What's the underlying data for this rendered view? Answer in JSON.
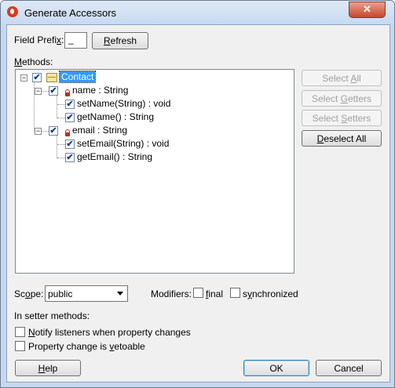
{
  "window": {
    "title": "Generate Accessors",
    "close_glyph": "✕"
  },
  "field_prefix": {
    "label": "Field Prefi",
    "label_accel": "x",
    "label_suffix": ":",
    "value": "_"
  },
  "refresh_button": {
    "accel": "R",
    "rest": "efresh"
  },
  "methods_label": {
    "accel": "M",
    "rest": "ethods:"
  },
  "tree": {
    "class_name": "Contact",
    "fields": [
      {
        "label": "name : String",
        "methods": [
          "setName(String) : void",
          "getName() : String"
        ]
      },
      {
        "label": "email : String",
        "methods": [
          "setEmail(String) : void",
          "getEmail() : String"
        ]
      }
    ],
    "check_glyph": "✔",
    "collapse_glyph": "−"
  },
  "side_buttons": {
    "select_all": {
      "pre": "Select ",
      "accel": "A",
      "post": "ll"
    },
    "select_getters": {
      "pre": "Select ",
      "accel": "G",
      "post": "etters"
    },
    "select_setters": {
      "pre": "Select ",
      "accel": "S",
      "post": "etters"
    },
    "deselect_all": {
      "pre": "",
      "accel": "D",
      "post": "eselect All"
    }
  },
  "scope": {
    "label_pre": "Sc",
    "label_accel": "o",
    "label_post": "pe:",
    "value": "public"
  },
  "modifiers": {
    "label": "Modifiers:",
    "final": {
      "accel": "f",
      "rest": "inal",
      "checked": false
    },
    "synchronized": {
      "pre": "s",
      "accel": "y",
      "post": "nchronized",
      "checked": false
    }
  },
  "setter_section": {
    "heading": "In setter methods:",
    "notify": {
      "accel": "N",
      "rest": "otify listeners when property changes",
      "checked": false
    },
    "vetoable": {
      "pre": "Property change is ",
      "accel": "v",
      "post": "etoable",
      "checked": false
    }
  },
  "footer": {
    "help": {
      "accel": "H",
      "rest": "elp"
    },
    "ok": "OK",
    "cancel": "Cancel"
  },
  "colors": {
    "selection": "#3399ff",
    "titlebar": "#c7daf0",
    "close": "#c7472c"
  }
}
